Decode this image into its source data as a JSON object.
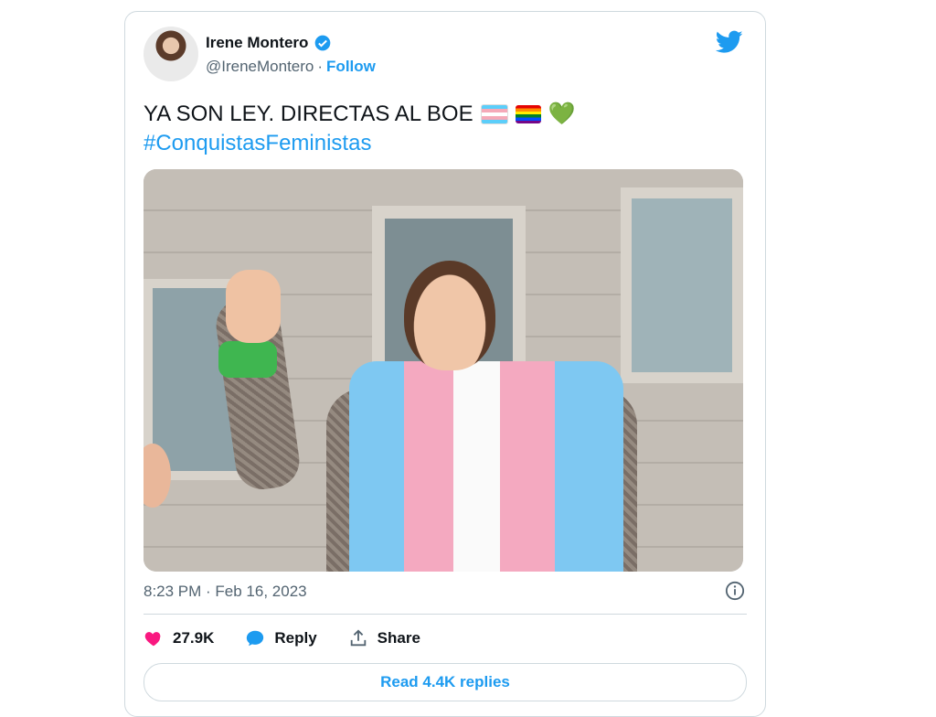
{
  "tweet": {
    "author_name": "Irene Montero",
    "handle": "@IreneMontero",
    "separator": "·",
    "follow_label": "Follow",
    "text_line1": "YA SON LEY. DIRECTAS AL BOE",
    "hashtag": "#ConquistasFeministas",
    "emoji_green_heart": "💚",
    "timestamp": "8:23 PM · Feb 16, 2023",
    "like_count": "27.9K",
    "reply_label": "Reply",
    "share_label": "Share",
    "read_replies_label": "Read 4.4K replies"
  },
  "colors": {
    "accent": "#1d9bf0",
    "like": "#f91880",
    "text": "#0f1419",
    "muted": "#536471"
  },
  "icons": [
    "verified-badge-icon",
    "twitter-bird-icon",
    "trans-flag-icon",
    "rainbow-flag-icon",
    "green-heart-icon",
    "info-icon",
    "heart-icon",
    "reply-bubble-icon",
    "share-icon"
  ]
}
